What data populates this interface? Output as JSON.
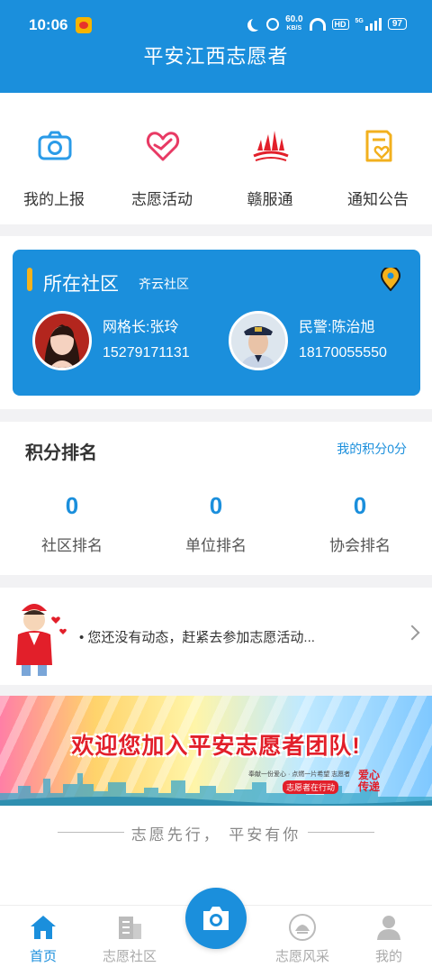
{
  "status_bar": {
    "time": "10:06",
    "net_speed": "60.0",
    "net_unit": "KB/S",
    "hd": "HD",
    "signal": "5G",
    "battery": "97"
  },
  "header": {
    "title": "平安江西志愿者"
  },
  "quick_menu": [
    {
      "label": "我的上报",
      "icon": "camera-icon",
      "color": "#2a9be8"
    },
    {
      "label": "志愿活动",
      "icon": "heart-icon",
      "color": "#e83a64"
    },
    {
      "label": "赣服通",
      "icon": "ganfutong-logo-icon",
      "color": "#e21f2a"
    },
    {
      "label": "通知公告",
      "icon": "notice-icon",
      "color": "#f2b01e"
    }
  ],
  "community": {
    "title": "所在社区",
    "name": "齐云社区",
    "grid_leader": {
      "role": "网格长:张玲",
      "phone": "15279171131"
    },
    "police": {
      "role": "民警:陈治旭",
      "phone": "18170055550"
    }
  },
  "ranking": {
    "title": "积分排名",
    "my_points": "我的积分0分",
    "items": [
      {
        "value": "0",
        "label": "社区排名"
      },
      {
        "value": "0",
        "label": "单位排名"
      },
      {
        "value": "0",
        "label": "协会排名"
      }
    ]
  },
  "feed": {
    "message": "• 您还没有动态，赶紧去参加志愿活动..."
  },
  "banner": {
    "headline": "欢迎您加入平安志愿者团队!",
    "subline": "奉献一份爱心 · 点燃一片希望  志愿者",
    "tag": "志愿者在行动",
    "heart_text": "爱心传递"
  },
  "slogan": "志愿先行， 平安有你",
  "tabs": [
    {
      "label": "首页",
      "icon": "home-icon",
      "active": true
    },
    {
      "label": "志愿社区",
      "icon": "community-icon",
      "active": false
    },
    {
      "label": "志愿风采",
      "icon": "style-icon",
      "active": false
    },
    {
      "label": "我的",
      "icon": "profile-icon",
      "active": false
    }
  ],
  "colors": {
    "primary": "#1b8fdc",
    "accent_yellow": "#f5b21a",
    "accent_red": "#e21f2a"
  }
}
